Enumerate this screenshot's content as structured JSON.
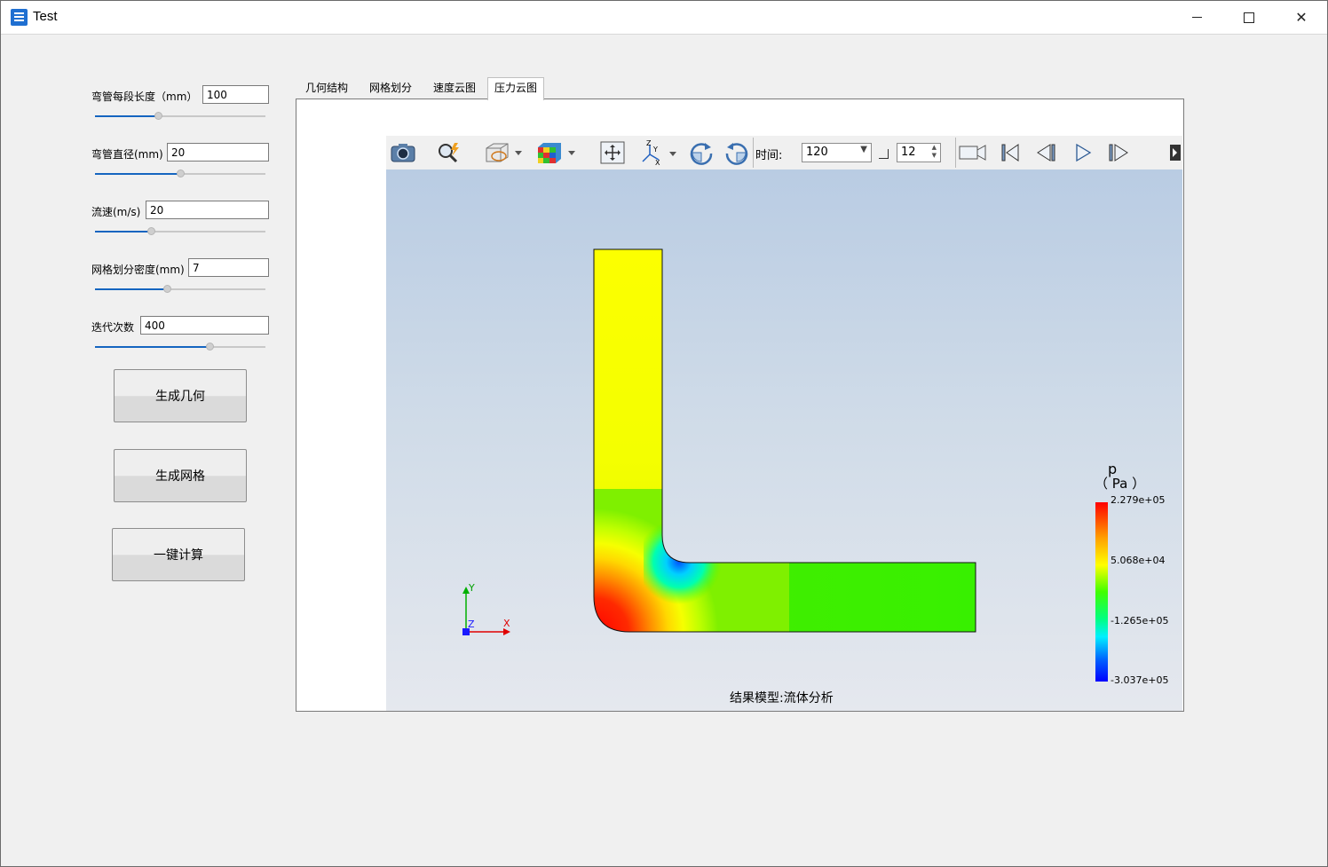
{
  "window": {
    "title": "Test"
  },
  "params": [
    {
      "label": "弯管每段长度（mm）",
      "value": "100",
      "slider_level": 0.37
    },
    {
      "label": "弯管直径(mm)",
      "value": "20",
      "slider_level": 0.5
    },
    {
      "label": "流速(m/s)",
      "value": "20",
      "slider_level": 0.33
    },
    {
      "label": "网格划分密度(mm)",
      "value": "7",
      "slider_level": 0.42
    },
    {
      "label": "迭代次数",
      "value": "400",
      "slider_level": 0.67
    }
  ],
  "buttons": {
    "gen_geometry": "生成几何",
    "gen_mesh": "生成网格",
    "compute": "一键计算"
  },
  "tabs": [
    {
      "label": "几何结构",
      "active": false
    },
    {
      "label": "网格划分",
      "active": false
    },
    {
      "label": "速度云图",
      "active": false
    },
    {
      "label": "压力云图",
      "active": true
    }
  ],
  "toolbar": {
    "time_label": "时间:",
    "time_value": "120",
    "step_value": "12",
    "icons": [
      "camera-icon",
      "query-icon",
      "surface-mode-icon",
      "display-mode-icon",
      "fit-view-icon",
      "axes-icon",
      "rotate-cw-icon",
      "rotate-ccw-icon",
      "record-icon",
      "first-frame-icon",
      "prev-frame-icon",
      "play-icon",
      "next-frame-icon"
    ]
  },
  "viewport": {
    "caption": "结果模型:流体分析",
    "axes": {
      "x": "X",
      "y": "Y",
      "z": "Z"
    },
    "legend": {
      "variable": "p",
      "unit": "（ Pa ）",
      "ticks": [
        "2.279e+05",
        "5.068e+04",
        "-1.265e+05",
        "-3.037e+05"
      ]
    }
  }
}
